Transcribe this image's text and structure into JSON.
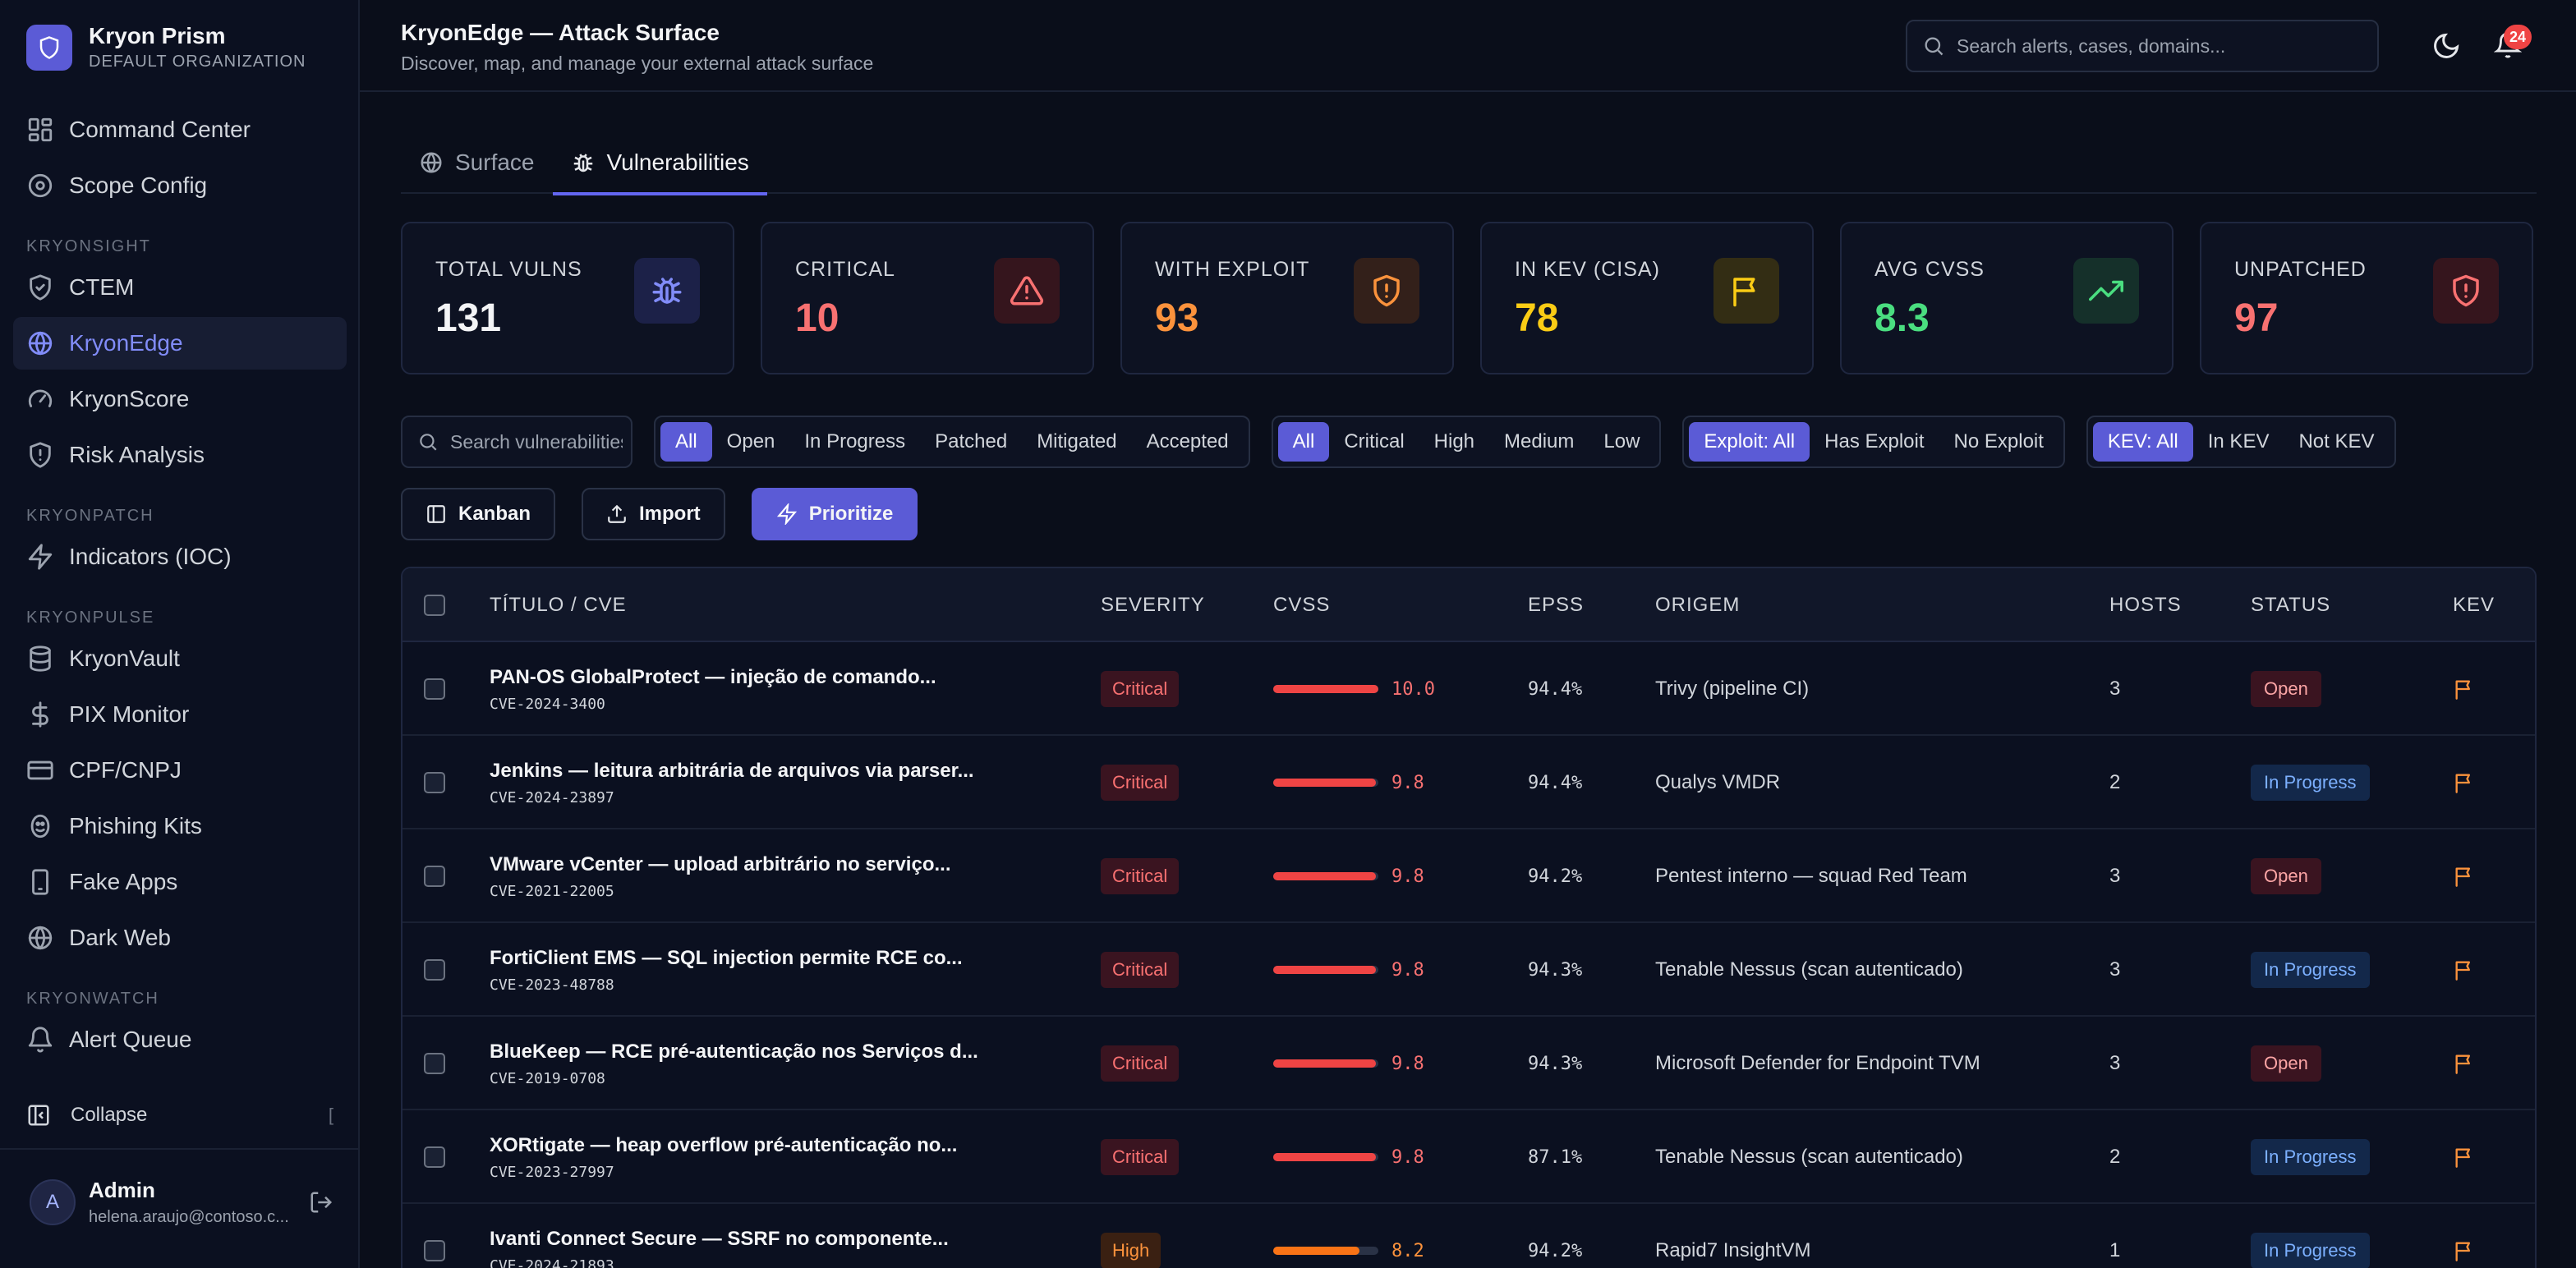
{
  "brand": {
    "name": "Kryon Prism",
    "org": "DEFAULT ORGANIZATION"
  },
  "sidebar": {
    "top_items": [
      {
        "label": "Command Center",
        "icon": "grid-icon"
      },
      {
        "label": "Scope Config",
        "icon": "target-icon"
      }
    ],
    "sections": [
      {
        "title": "KRYONSIGHT",
        "items": [
          {
            "label": "CTEM",
            "icon": "shield-check-icon"
          },
          {
            "label": "KryonEdge",
            "icon": "globe-icon",
            "active": true
          },
          {
            "label": "KryonScore",
            "icon": "gauge-icon"
          },
          {
            "label": "Risk Analysis",
            "icon": "shield-alert-icon"
          }
        ]
      },
      {
        "title": "KRYONPATCH",
        "items": [
          {
            "label": "Indicators (IOC)",
            "icon": "zap-icon"
          }
        ]
      },
      {
        "title": "KRYONPULSE",
        "items": [
          {
            "label": "KryonVault",
            "icon": "database-icon"
          },
          {
            "label": "PIX Monitor",
            "icon": "dollar-icon"
          },
          {
            "label": "CPF/CNPJ",
            "icon": "card-icon"
          },
          {
            "label": "Phishing Kits",
            "icon": "fish-icon"
          },
          {
            "label": "Fake Apps",
            "icon": "phone-icon"
          },
          {
            "label": "Dark Web",
            "icon": "globe-icon"
          }
        ]
      },
      {
        "title": "KRYONWATCH",
        "items": [
          {
            "label": "Alert Queue",
            "icon": "bell-icon"
          }
        ]
      }
    ],
    "collapse_label": "Collapse",
    "collapse_key": "[",
    "user": {
      "initial": "A",
      "name": "Admin",
      "email": "helena.araujo@contoso.c..."
    }
  },
  "header": {
    "title": "KryonEdge — Attack Surface",
    "subtitle": "Discover, map, and manage your external attack surface",
    "search_placeholder": "Search alerts, cases, domains...",
    "notification_count": "24"
  },
  "tabs": [
    {
      "label": "Surface",
      "active": false
    },
    {
      "label": "Vulnerabilities",
      "active": true
    }
  ],
  "stats": [
    {
      "label": "TOTAL VULNS",
      "value": "131",
      "color": "#f3f4f6",
      "icon": "bug-icon",
      "icon_color": "#818cf8",
      "icon_bg": "#1c2148"
    },
    {
      "label": "CRITICAL",
      "value": "10",
      "color": "#f87171",
      "icon": "alert-triangle-icon",
      "icon_color": "#f87171",
      "icon_bg": "#35151d"
    },
    {
      "label": "WITH EXPLOIT",
      "value": "93",
      "color": "#fb923c",
      "icon": "shield-alert-icon",
      "icon_color": "#fb923c",
      "icon_bg": "#33201a"
    },
    {
      "label": "IN KEV (CISA)",
      "value": "78",
      "color": "#facc15",
      "icon": "flag-icon",
      "icon_color": "#facc15",
      "icon_bg": "#332d14"
    },
    {
      "label": "AVG CVSS",
      "value": "8.3",
      "color": "#4ade80",
      "icon": "trending-up-icon",
      "icon_color": "#4ade80",
      "icon_bg": "#15302a"
    },
    {
      "label": "UNPATCHED",
      "value": "97",
      "color": "#f87171",
      "icon": "shield-alert-icon",
      "icon_color": "#f87171",
      "icon_bg": "#35151d"
    }
  ],
  "filters": {
    "search_placeholder": "Search vulnerabilities...",
    "status": [
      "All",
      "Open",
      "In Progress",
      "Patched",
      "Mitigated",
      "Accepted"
    ],
    "severity": [
      "All",
      "Critical",
      "High",
      "Medium",
      "Low"
    ],
    "exploit": [
      "Exploit: All",
      "Has Exploit",
      "No Exploit"
    ],
    "kev": [
      "KEV: All",
      "In KEV",
      "Not KEV"
    ]
  },
  "actions": {
    "kanban": "Kanban",
    "import": "Import",
    "prioritize": "Prioritize"
  },
  "table": {
    "columns": [
      "TÍTULO / CVE",
      "SEVERITY",
      "CVSS",
      "EPSS",
      "ORIGEM",
      "HOSTS",
      "STATUS",
      "KEV"
    ],
    "rows": [
      {
        "title": "PAN-OS GlobalProtect — injeção de comando...",
        "cve": "CVE-2024-3400",
        "severity": "Critical",
        "cvss": 10.0,
        "cvss_label": "10.0",
        "epss": "94.4%",
        "origem": "Trivy (pipeline CI)",
        "hosts": "3",
        "status": "Open"
      },
      {
        "title": "Jenkins — leitura arbitrária de arquivos via parser...",
        "cve": "CVE-2024-23897",
        "severity": "Critical",
        "cvss": 9.8,
        "cvss_label": "9.8",
        "epss": "94.4%",
        "origem": "Qualys VMDR",
        "hosts": "2",
        "status": "In Progress"
      },
      {
        "title": "VMware vCenter — upload arbitrário no serviço...",
        "cve": "CVE-2021-22005",
        "severity": "Critical",
        "cvss": 9.8,
        "cvss_label": "9.8",
        "epss": "94.2%",
        "origem": "Pentest interno — squad Red Team",
        "hosts": "3",
        "status": "Open"
      },
      {
        "title": "FortiClient EMS — SQL injection permite RCE co...",
        "cve": "CVE-2023-48788",
        "severity": "Critical",
        "cvss": 9.8,
        "cvss_label": "9.8",
        "epss": "94.3%",
        "origem": "Tenable Nessus (scan autenticado)",
        "hosts": "3",
        "status": "In Progress"
      },
      {
        "title": "BlueKeep — RCE pré-autenticação nos Serviços d...",
        "cve": "CVE-2019-0708",
        "severity": "Critical",
        "cvss": 9.8,
        "cvss_label": "9.8",
        "epss": "94.3%",
        "origem": "Microsoft Defender for Endpoint TVM",
        "hosts": "3",
        "status": "Open"
      },
      {
        "title": "XORtigate — heap overflow pré-autenticação no...",
        "cve": "CVE-2023-27997",
        "severity": "Critical",
        "cvss": 9.8,
        "cvss_label": "9.8",
        "epss": "87.1%",
        "origem": "Tenable Nessus (scan autenticado)",
        "hosts": "2",
        "status": "In Progress"
      },
      {
        "title": "Ivanti Connect Secure — SSRF no componente...",
        "cve": "CVE-2024-21893",
        "severity": "High",
        "cvss": 8.2,
        "cvss_label": "8.2",
        "epss": "94.2%",
        "origem": "Rapid7 InsightVM",
        "hosts": "1",
        "status": "In Progress"
      }
    ]
  },
  "colors": {
    "accent": "#5b5bd6",
    "critical": "#ef4444",
    "high": "#f97316",
    "kev_flag": "#fb923c"
  }
}
